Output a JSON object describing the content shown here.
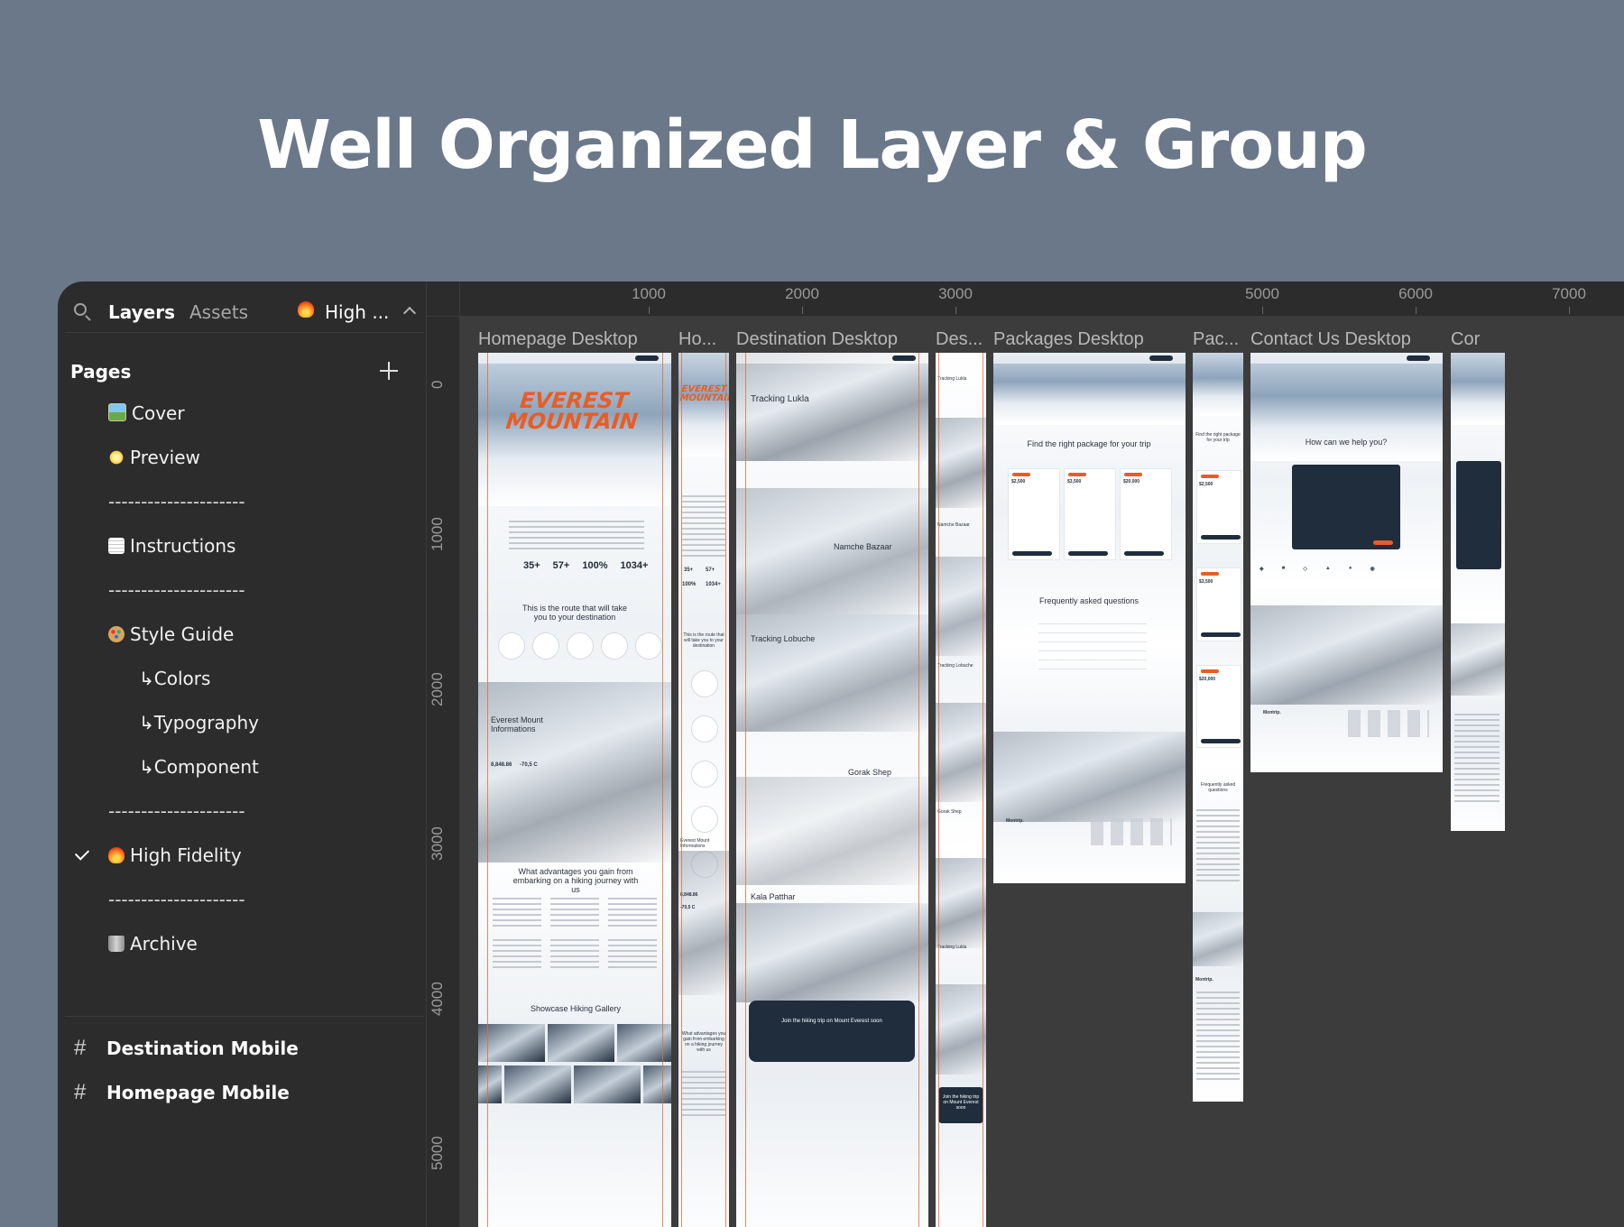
{
  "headline": "Well Organized Layer & Group",
  "panel": {
    "tabs": {
      "layers": "Layers",
      "assets": "Assets"
    },
    "current_page": "High ...",
    "pages_header": "Pages",
    "pages": [
      {
        "label": "Cover"
      },
      {
        "label": "Preview"
      },
      {
        "label": "---------------------"
      },
      {
        "label": "Instructions"
      },
      {
        "label": "---------------------"
      },
      {
        "label": "Style Guide"
      },
      {
        "label": "↳Colors"
      },
      {
        "label": "↳Typography"
      },
      {
        "label": "↳Component"
      },
      {
        "label": "---------------------"
      },
      {
        "label": "High Fidelity"
      },
      {
        "label": "---------------------"
      },
      {
        "label": "Archive"
      }
    ],
    "layers": [
      {
        "label": "Destination Mobile"
      },
      {
        "label": "Homepage Mobile"
      }
    ]
  },
  "ruler": {
    "x_ticks": [
      "1000",
      "2000",
      "3000",
      "5000",
      "6000",
      "7000"
    ],
    "y_ticks": [
      "0",
      "1000",
      "2000",
      "3000",
      "4000",
      "5000"
    ]
  },
  "frames": [
    {
      "label": "Homepage Desktop"
    },
    {
      "label": "Ho..."
    },
    {
      "label": "Destination Desktop"
    },
    {
      "label": "Des..."
    },
    {
      "label": "Packages Desktop"
    },
    {
      "label": "Pac..."
    },
    {
      "label": "Contact Us Desktop"
    },
    {
      "label": "Cor"
    }
  ],
  "homepage": {
    "hero_title": "EVEREST MOUNTAIN",
    "stats": [
      "35+",
      "57+",
      "100%",
      "1034+"
    ],
    "route_heading": "This is the route that will take you to your destination",
    "info_heading": "Everest Mount Informations",
    "altitude": "8,848.86",
    "temperature": "-70,5 C",
    "advantages_heading": "What advantages you gain from embarking on a hiking journey with us",
    "gallery_heading": "Showcase Hiking Gallery"
  },
  "homepage_mobile": {
    "hero_title": "EVEREST MOUNTAIN",
    "stats": [
      "35+",
      "57+",
      "100%",
      "1034+"
    ],
    "route_heading": "This is the route that will take you to your destination",
    "info_heading": "Everest Mount Informations",
    "altitude": "8,848.86",
    "temperature": "-70,5 C",
    "advantages_heading": "What advantages you gain from embarking on a hiking journey with us"
  },
  "destination": {
    "stops": [
      "Tracking Lukla",
      "Namche Bazaar",
      "Tracking Lobuche",
      "Gorak Shep",
      "Kala Patthar"
    ],
    "cta": "Join the hiking trip on Mount Everest soon"
  },
  "destination_mobile": {
    "stops": [
      "Tracking Lukla",
      "Namche Bazaar",
      "Tracking Lobuche",
      "Gorak Shep",
      "Tracking Lukla"
    ],
    "cta": "Join the hiking trip on Mount Everest soon"
  },
  "packages": {
    "heading": "Find the right package for your trip",
    "prices": [
      "$2,500",
      "$3,500",
      "$20,000"
    ],
    "faq_heading": "Frequently asked questions",
    "footer_brand": "Montrip."
  },
  "packages_mobile": {
    "heading": "Find the right package for your trip",
    "prices": [
      "$2,500",
      "$3,500",
      "$20,000"
    ],
    "faq_heading": "Frequently asked questions",
    "footer_brand": "Montrip."
  },
  "contact": {
    "heading": "How can we help you?",
    "footer_brand": "Montrip."
  },
  "colors": {
    "background": "#6b7889",
    "panel": "#2c2c2c",
    "canvas": "#3c3c3c",
    "accent": "#e85d25",
    "navy": "#1f2d3d"
  }
}
